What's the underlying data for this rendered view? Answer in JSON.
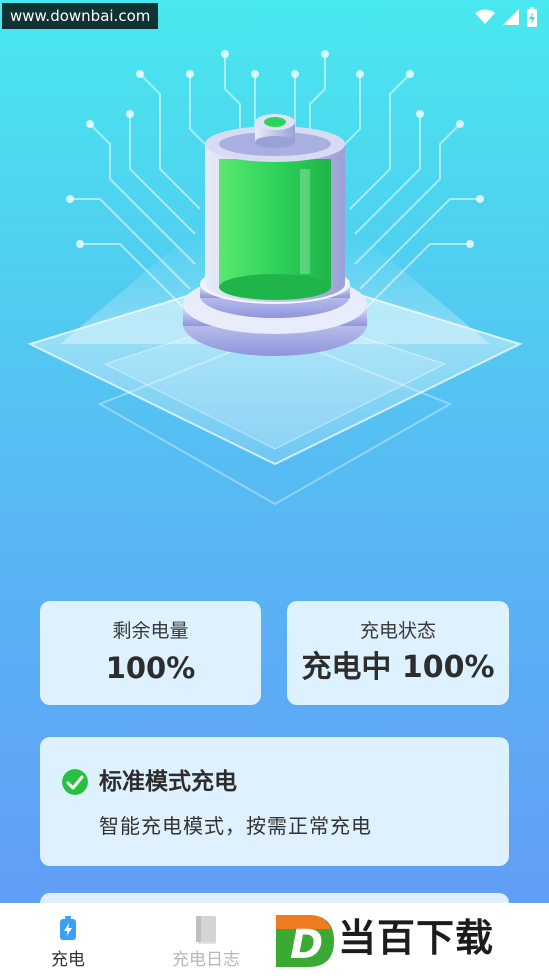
{
  "status_bar": {
    "watermark": "www.downbai.com",
    "icons": [
      "wifi-icon",
      "signal-icon",
      "battery-charging-icon"
    ]
  },
  "stats": {
    "remaining_label": "剩余电量",
    "remaining_value": "100%",
    "status_label": "充电状态",
    "status_value": "充电中 100%"
  },
  "mode": {
    "title": "标准模式充电",
    "description": "智能充电模式，按需正常充电"
  },
  "nav": {
    "items": [
      {
        "label": "充电",
        "icon": "battery-bolt-icon",
        "active": true
      },
      {
        "label": "充电日志",
        "icon": "book-icon",
        "active": false
      }
    ]
  },
  "branding": {
    "logo_letter": "D",
    "text": "当百下载"
  },
  "colors": {
    "background_top": "#49e8ee",
    "background_bottom": "#6399f8",
    "battery_green": "#2ed35a",
    "check_green": "#28c040",
    "brand_orange": "#f07a1e",
    "brand_green": "#3aaa35"
  }
}
